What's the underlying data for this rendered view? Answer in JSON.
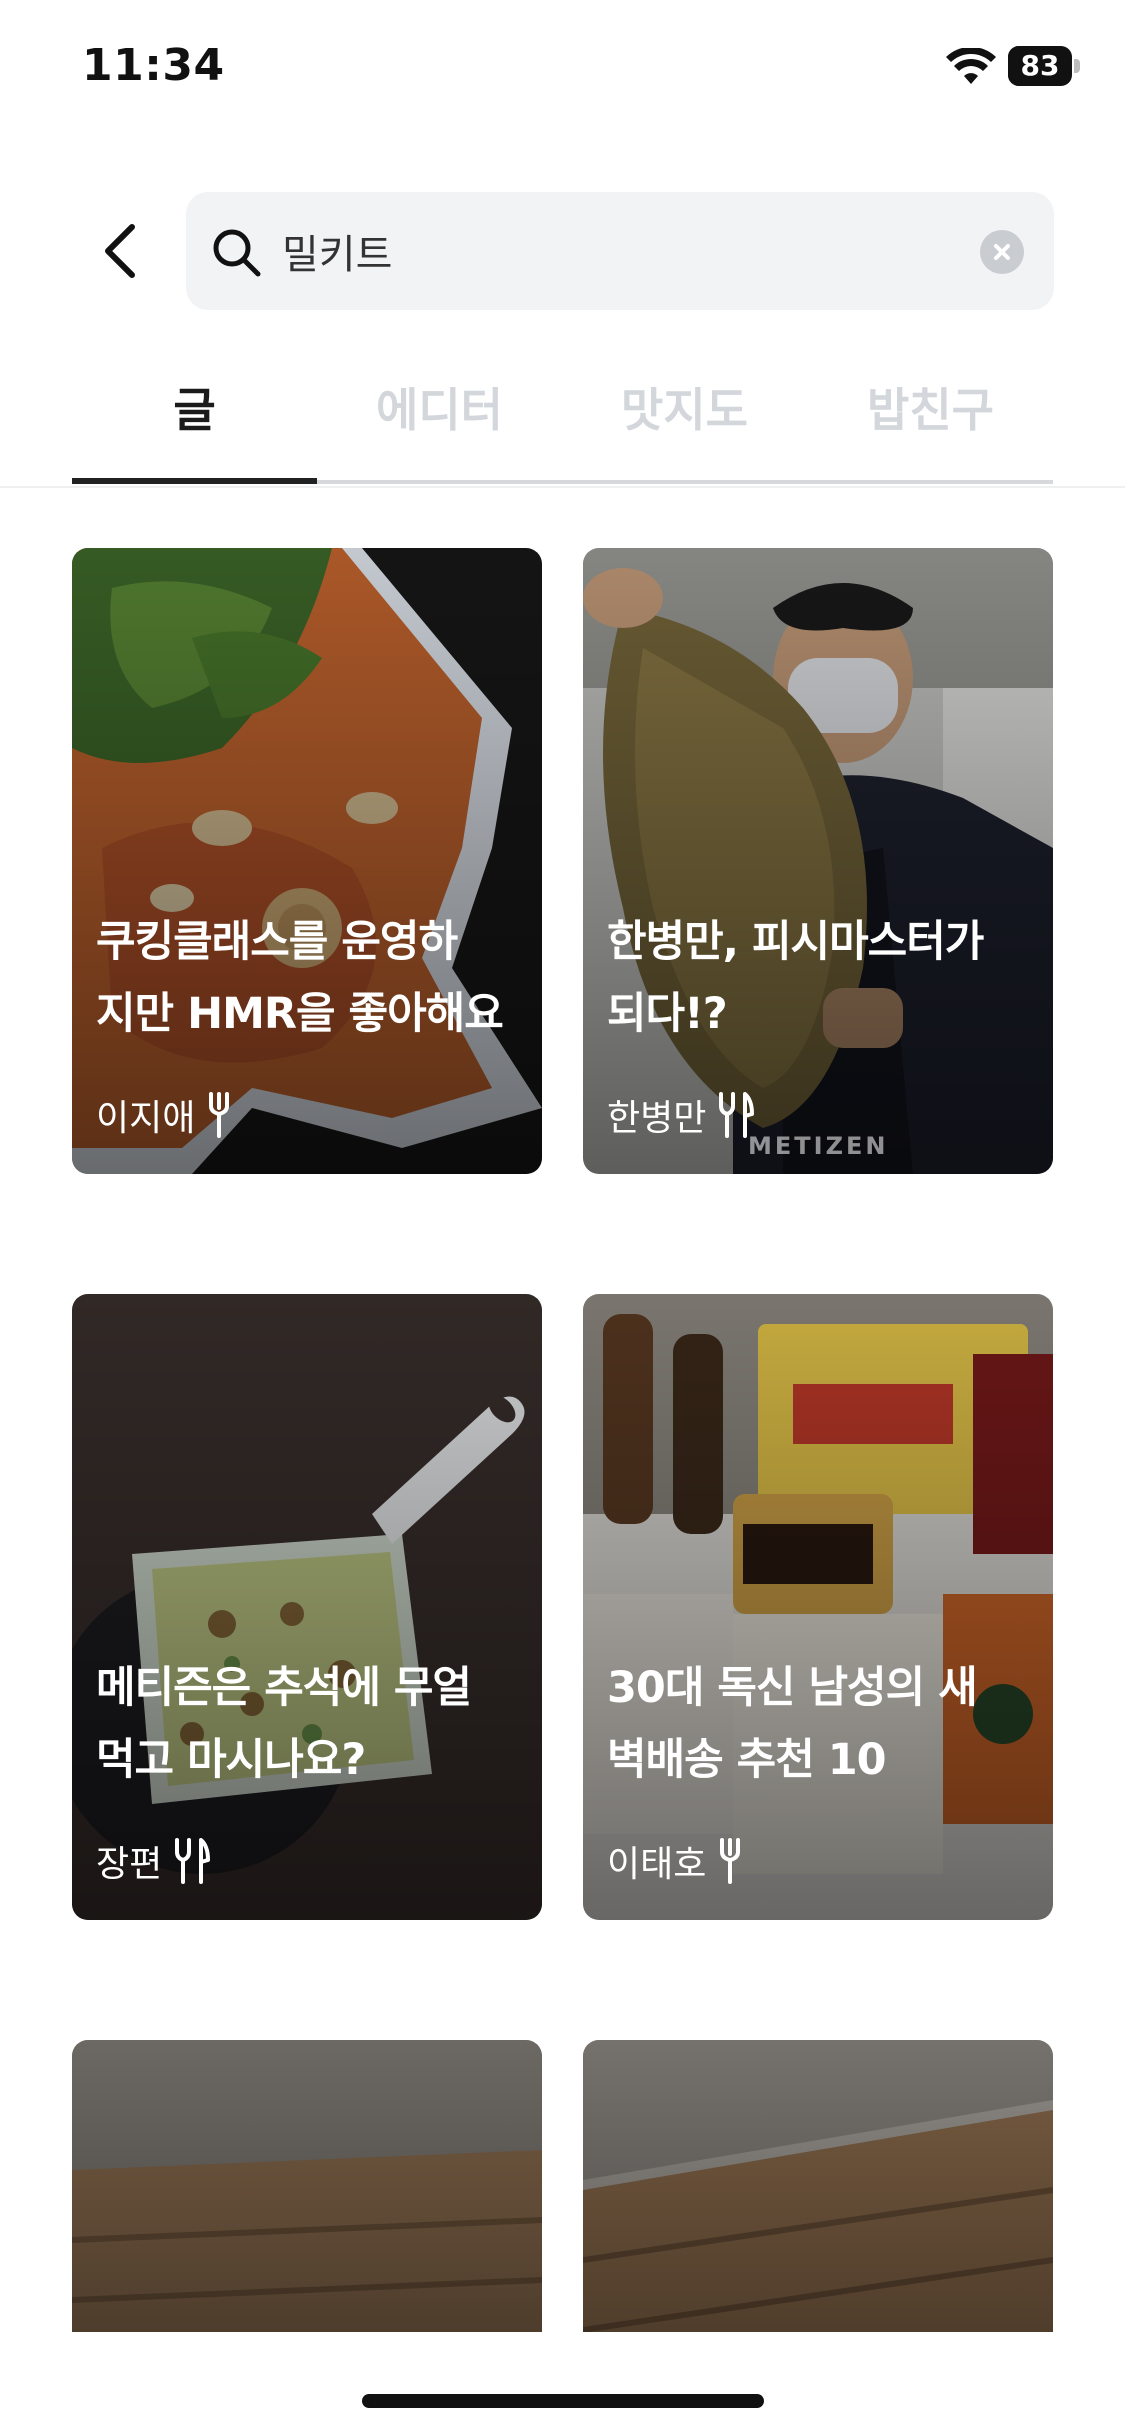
{
  "status_bar": {
    "time": "11:34",
    "battery": "83",
    "battery_level": 0.83,
    "icons": [
      "wifi-icon",
      "battery-icon"
    ]
  },
  "search": {
    "query": "밀키트",
    "icons": [
      "chevron-left-icon",
      "search-icon",
      "clear-icon"
    ]
  },
  "tabs": [
    {
      "label": "글",
      "active": true
    },
    {
      "label": "에디터",
      "active": false
    },
    {
      "label": "맛지도",
      "active": false
    },
    {
      "label": "밥친구",
      "active": false
    }
  ],
  "posts": [
    {
      "title": "쿠킹클래스를 운영하\n지만 HMR을 좋아해요",
      "author": "이지애",
      "icon": "fork-icon"
    },
    {
      "title": "한병만, 피시마스터가\n되다!?",
      "author": "한병만",
      "icon": "fork-knife-icon",
      "watermark": "METIZEN"
    },
    {
      "title": "메티즌은 추석에 무얼\n먹고 마시나요?",
      "author": "장편",
      "icon": "fork-knife-icon"
    },
    {
      "title": "30대 독신 남성의 새\n벽배송 추천 10",
      "author": "이태호",
      "icon": "fork-icon"
    },
    {
      "title": "",
      "author": "",
      "icon": ""
    },
    {
      "title": "",
      "author": "",
      "icon": ""
    }
  ],
  "colors": {
    "accent": "#222222",
    "tab_inactive": "#d3d6db",
    "search_bg": "#f2f3f5"
  }
}
